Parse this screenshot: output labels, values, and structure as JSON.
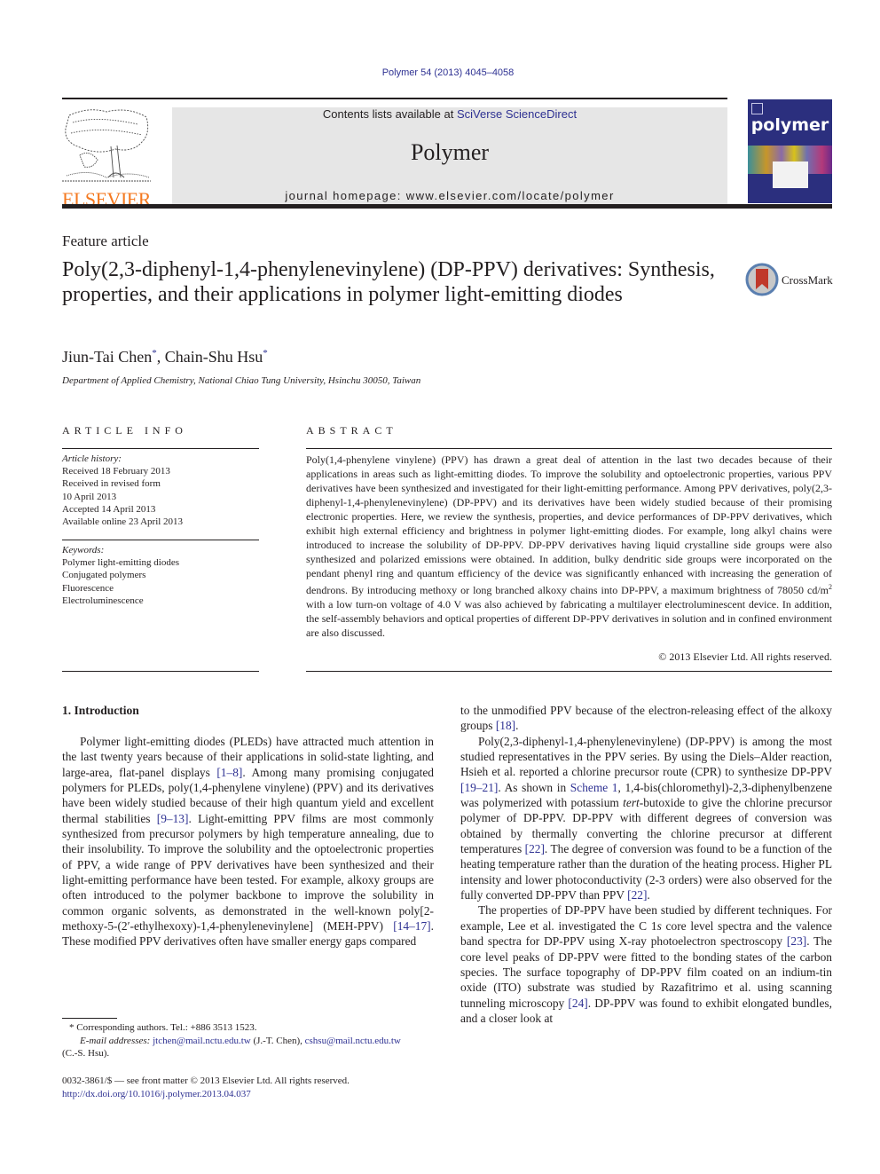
{
  "header": {
    "citation": "Polymer 54 (2013) 4045–4058",
    "contents_prefix": "Contents lists available at ",
    "contents_link": "SciVerse ScienceDirect",
    "journal_name": "Polymer",
    "homepage": "journal homepage: www.elsevier.com/locate/polymer",
    "publisher_logo": "ELSEVIER",
    "cover_title": "polymer",
    "colors": {
      "elsevier_orange": "#f47920",
      "link_blue": "#2e3192",
      "band_gray": "#e6e6e6",
      "cover_blue": "#2b2f7e"
    }
  },
  "article": {
    "type": "Feature article",
    "title": "Poly(2,3-diphenyl-1,4-phenylenevinylene) (DP-PPV) derivatives: Synthesis, properties, and their applications in polymer light-emitting diodes",
    "crossmark_label": "CrossMark",
    "authors": [
      {
        "name": "Jiun-Tai Chen",
        "mark": "*"
      },
      {
        "name": "Chain-Shu Hsu",
        "mark": "*"
      }
    ],
    "author_sep": ", ",
    "affiliation": "Department of Applied Chemistry, National Chiao Tung University, Hsinchu 30050, Taiwan"
  },
  "article_info": {
    "heading": "ARTICLE INFO",
    "history_label": "Article history:",
    "history": [
      "Received 18 February 2013",
      "Received in revised form",
      "10 April 2013",
      "Accepted 14 April 2013",
      "Available online 23 April 2013"
    ],
    "keywords_label": "Keywords:",
    "keywords": [
      "Polymer light-emitting diodes",
      "Conjugated polymers",
      "Fluorescence",
      "Electroluminescence"
    ]
  },
  "abstract": {
    "heading": "ABSTRACT",
    "text_a": "Poly(1,4-phenylene vinylene) (PPV) has drawn a great deal of attention in the last two decades because of their applications in areas such as light-emitting diodes. To improve the solubility and optoelectronic properties, various PPV derivatives have been synthesized and investigated for their light-emitting performance. Among PPV derivatives, poly(2,3-diphenyl-1,4-phenylenevinylene) (DP-PPV) and its derivatives have been widely studied because of their promising electronic properties. Here, we review the synthesis, properties, and device performances of DP-PPV derivatives, which exhibit high external efficiency and brightness in polymer light-emitting diodes. For example, long alkyl chains were introduced to increase the solubility of DP-PPV. DP-PPV derivatives having liquid crystalline side groups were also synthesized and polarized emissions were obtained. In addition, bulky dendritic side groups were incorporated on the pendant phenyl ring and quantum efficiency of the device was significantly enhanced with increasing the generation of dendrons. By introducing methoxy or long branched alkoxy chains into DP-PPV, a maximum brightness of 78050 cd/m",
    "text_sup": "2",
    "text_b": " with a low turn-on voltage of 4.0 V was also achieved by fabricating a multilayer electroluminescent device. In addition, the self-assembly behaviors and optical properties of different DP-PPV derivatives in solution and in confined environment are also discussed.",
    "copyright": "© 2013 Elsevier Ltd. All rights reserved."
  },
  "body": {
    "section_heading": "1.  Introduction",
    "left": {
      "p1_1": "Polymer light-emitting diodes (PLEDs) have attracted much attention in the last twenty years because of their applications in solid-state lighting, and large-area, flat-panel displays ",
      "ref_1_8": "[1–8]",
      "p1_2": ". Among many promising conjugated polymers for PLEDs, poly(1,4-phenylene vinylene) (PPV) and its derivatives have been widely studied because of their high quantum yield and excellent thermal stabilities ",
      "ref_9_13": "[9–13]",
      "p1_3": ". Light-emitting PPV films are most commonly synthesized from precursor polymers by high temperature annealing, due to their insolubility. To improve the solubility and the optoelectronic properties of PPV, a wide range of PPV derivatives have been synthesized and their light-emitting performance have been tested. For example, alkoxy groups are often introduced to the polymer backbone to improve the solubility in common organic solvents, as demonstrated in the well-known poly[2-methoxy-5-(2′-ethylhexoxy)-1,4-phenylenevinylene] (MEH-PPV) ",
      "ref_14_17": "[14–17]",
      "p1_4": ". These modified PPV derivatives often have smaller energy gaps compared"
    },
    "right": {
      "p0_1": "to the unmodified PPV because of the electron-releasing effect of the alkoxy groups ",
      "ref_18": "[18]",
      "p0_2": ".",
      "p2_1": "Poly(2,3-diphenyl-1,4-phenylenevinylene) (DP-PPV) is among the most studied representatives in the PPV series. By using the Diels–Alder reaction, Hsieh et al. reported a chlorine precursor route (CPR) to synthesize DP-PPV ",
      "ref_19_21": "[19–21]",
      "p2_2": ". As shown in ",
      "scheme_1": "Scheme 1",
      "p2_3": ", 1,4-bis(chloromethyl)-2,3-diphenylbenzene was polymerized with potassium ",
      "p2_tert": "tert",
      "p2_4": "-butoxide to give the chlorine precursor polymer of DP-PPV. DP-PPV with different degrees of conversion was obtained by thermally converting the chlorine precursor at different temperatures ",
      "ref_22a": "[22]",
      "p2_5": ". The degree of conversion was found to be a function of the heating temperature rather than the duration of the heating process. Higher PL intensity and lower photoconductivity (2-3 orders) were also observed for the fully converted DP-PPV than PPV ",
      "ref_22b": "[22]",
      "p2_6": ".",
      "p3_1": "The properties of DP-PPV have been studied by different techniques. For example, Lee et al. investigated the C 1",
      "p3_s": "s",
      "p3_2": " core level spectra and the valence band spectra for DP-PPV using X-ray photoelectron spectroscopy ",
      "ref_23": "[23]",
      "p3_3": ". The core level peaks of DP-PPV were fitted to the bonding states of the carbon species. The surface topography of DP-PPV film coated on an indium-tin oxide (ITO) substrate was studied by Razafitrimo et al. using scanning tunneling microscopy ",
      "ref_24": "[24]",
      "p3_4": ". DP-PPV was found to exhibit elongated bundles, and a closer look at"
    }
  },
  "footnotes": {
    "corresponding": "* Corresponding authors. Tel.: +886 3513 1523.",
    "email_label": "E-mail addresses: ",
    "email1": "jtchen@mail.nctu.edu.tw",
    "email1_who": " (J.-T. Chen), ",
    "email2": "cshsu@mail.nctu.edu.tw",
    "email2_who": "(C.-S. Hsu).",
    "issn": "0032-3861/$ — see front matter © 2013 Elsevier Ltd. All rights reserved.",
    "doi": "http://dx.doi.org/10.1016/j.polymer.2013.04.037"
  }
}
